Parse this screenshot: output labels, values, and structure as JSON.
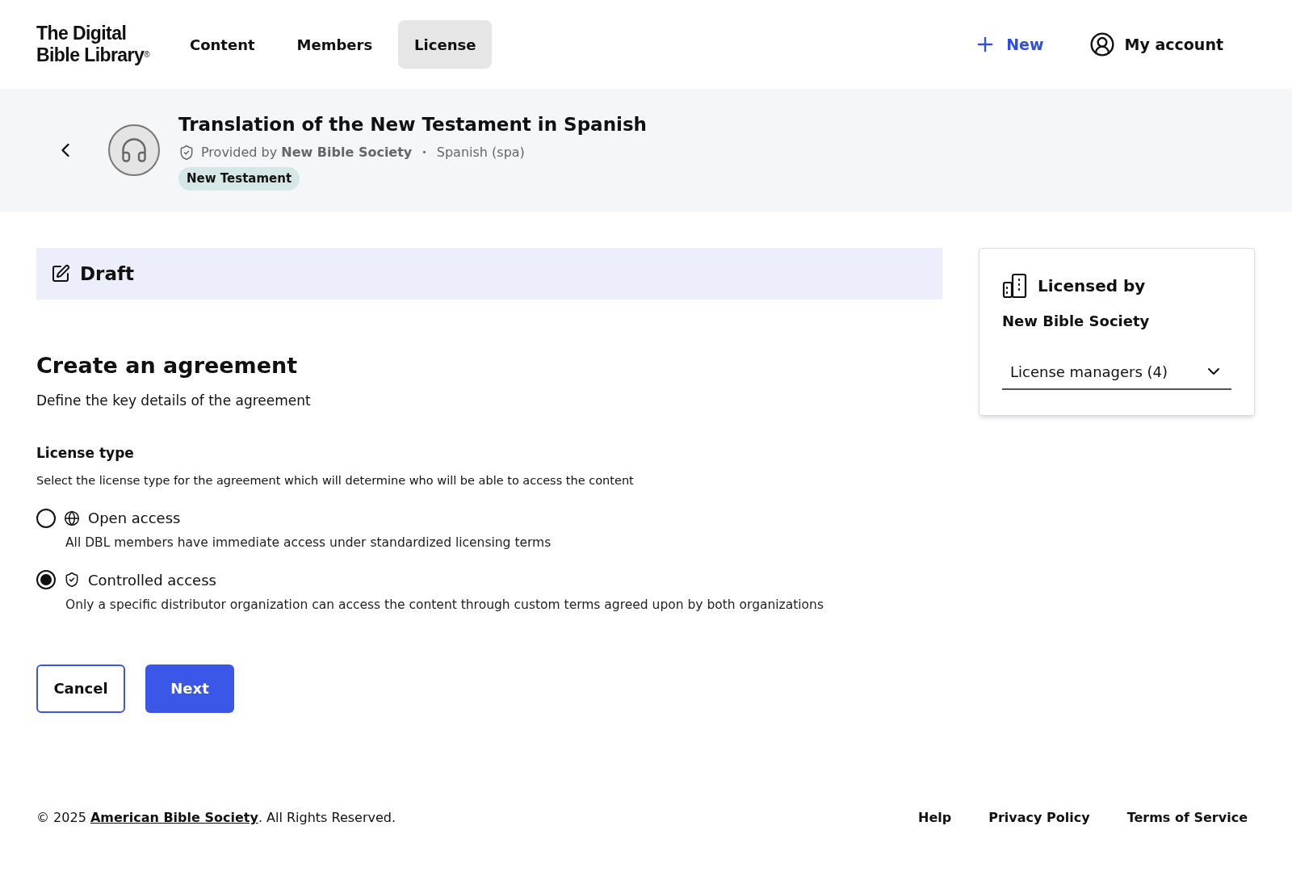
{
  "brand": {
    "line1": "The Digital",
    "line2": "Bible Library",
    "mark": "®"
  },
  "nav": [
    {
      "label": "Content",
      "selected": false
    },
    {
      "label": "Members",
      "selected": false
    },
    {
      "label": "License",
      "selected": true
    }
  ],
  "actions": {
    "new": "New",
    "account": "My account"
  },
  "resource": {
    "title": "Translation of the New Testament in Spanish",
    "provided": "Provided by **New Bible Society**",
    "separator": "•",
    "language": "Spanish (spa)",
    "tag": "New Testament"
  },
  "status": {
    "label": "Draft"
  },
  "form": {
    "title": "Create an agreement",
    "subtitle": "Define the key details of the agreement",
    "section": "License type",
    "hint": "Select the license type for the agreement which will determine who will be able to access the content",
    "options": [
      {
        "kind": "globe",
        "label": "Open access",
        "description": "All DBL members have immediate access under standardized licensing terms",
        "selected": false
      },
      {
        "kind": "shield",
        "label": "Controlled access",
        "description": "Only a specific distributor organization can access the content through custom terms agreed upon by both organizations",
        "selected": true
      }
    ],
    "buttons": {
      "cancel": "Cancel",
      "next": "Next"
    }
  },
  "licensor": {
    "title": "Licensed by",
    "name": "New Bible Society",
    "dropdown": "License managers (4)"
  },
  "footer": {
    "prefix": "© 2025 ",
    "link": "American Bible Society",
    "suffix": ". All Rights Reserved.",
    "links": [
      "Help",
      "Privacy Policy",
      "Terms of Service"
    ]
  }
}
